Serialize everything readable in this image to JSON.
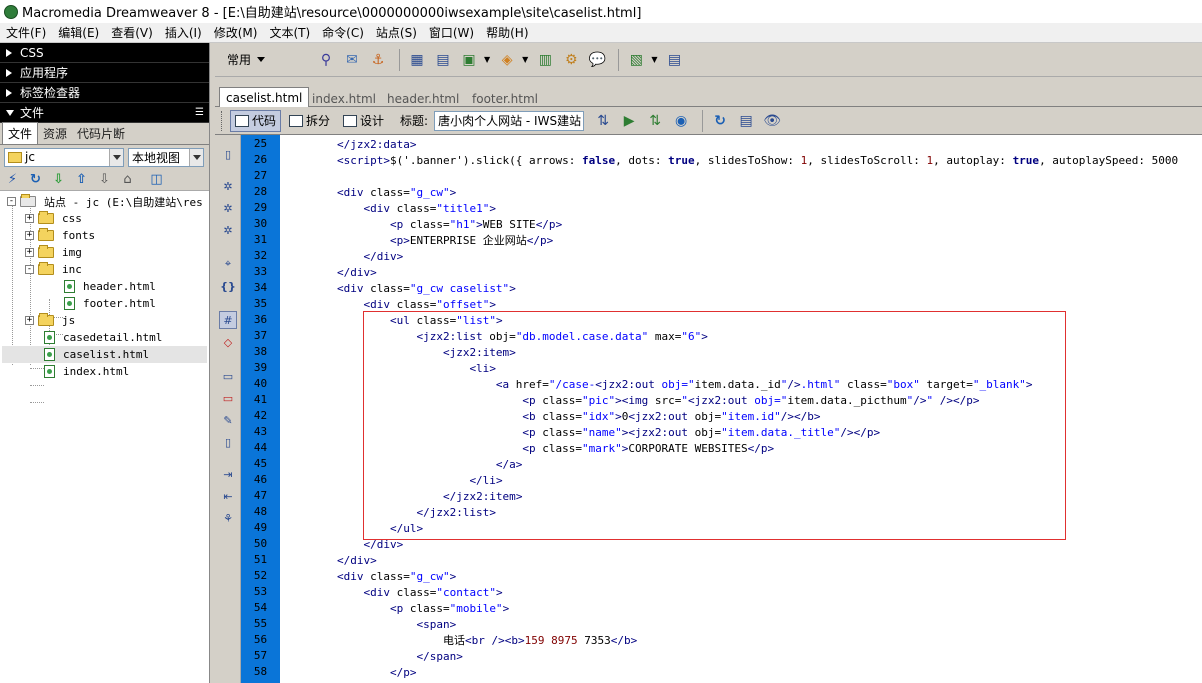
{
  "window": {
    "title": "Macromedia Dreamweaver 8 - [E:\\自助建站\\resource\\0000000000iwsexample\\site\\caselist.html]"
  },
  "menu": [
    "文件(F)",
    "编辑(E)",
    "查看(V)",
    "插入(I)",
    "修改(M)",
    "文本(T)",
    "命令(C)",
    "站点(S)",
    "窗口(W)",
    "帮助(H)"
  ],
  "panels": {
    "css": "CSS",
    "app": "应用程序",
    "tag_inspector": "标签检查器",
    "files": "文件"
  },
  "files_panel": {
    "tabs": [
      "文件",
      "资源",
      "代码片断"
    ],
    "site_select": "jc",
    "view_select": "本地视图",
    "tree": [
      {
        "label": "站点 - jc (E:\\自助建站\\res",
        "type": "site",
        "expander": "-"
      },
      {
        "label": "css",
        "type": "folder",
        "expander": "+"
      },
      {
        "label": "fonts",
        "type": "folder",
        "expander": "+"
      },
      {
        "label": "img",
        "type": "folder",
        "expander": "+"
      },
      {
        "label": "inc",
        "type": "folder",
        "expander": "-"
      },
      {
        "label": "header.html",
        "type": "file"
      },
      {
        "label": "footer.html",
        "type": "file"
      },
      {
        "label": "js",
        "type": "folder",
        "expander": "+"
      },
      {
        "label": "casedetail.html",
        "type": "file"
      },
      {
        "label": "caselist.html",
        "type": "file",
        "selected": true
      },
      {
        "label": "index.html",
        "type": "file"
      }
    ]
  },
  "insert_bar": {
    "category": "常用"
  },
  "doc_tabs": [
    "caselist.html",
    "index.html",
    "header.html",
    "footer.html"
  ],
  "doc_toolbar": {
    "code": "代码",
    "split": "拆分",
    "design": "设计",
    "title_label": "标题:",
    "title_value": "唐小肉个人网站 - IWS建站"
  },
  "editor": {
    "line_numbers": [
      "25",
      "26",
      "27",
      "28",
      "29",
      "30",
      "31",
      "32",
      "33",
      "34",
      "35",
      "36",
      "37",
      "38",
      "39",
      "40",
      "41",
      "42",
      "43",
      "44",
      "45",
      "46",
      "47",
      "48",
      "49",
      "50",
      "51",
      "52",
      "53",
      "54",
      "55",
      "56",
      "57",
      "58"
    ],
    "lines": [
      "        </jzx2:data>",
      "        <script>$('.banner').slick({ arrows: false, dots: true, slidesToShow: 1, slidesToScroll: 1, autoplay: true, autoplaySpeed: 5000",
      "",
      "        <div class=\"g_cw\">",
      "            <div class=\"title1\">",
      "                <p class=\"h1\">WEB SITE</p>",
      "                <p>ENTERPRISE 企业网站</p>",
      "            </div>",
      "        </div>",
      "        <div class=\"g_cw caselist\">",
      "            <div class=\"offset\">",
      "                <ul class=\"list\">",
      "                    <jzx2:list obj=\"db.model.case.data\" max=\"6\">",
      "                        <jzx2:item>",
      "                            <li>",
      "                                <a href=\"/case-<jzx2:out obj=\"item.data._id\"/>.html\" class=\"box\" target=\"_blank\">",
      "                                    <p class=\"pic\"><img src=\"<jzx2:out obj=\"item.data._picthum\"/>\" /></p>",
      "                                    <b class=\"idx\">0<jzx2:out obj=\"item.id\"/></b>",
      "                                    <p class=\"name\"><jzx2:out obj=\"item.data._title\"/></p>",
      "                                    <p class=\"mark\">CORPORATE WEBSITES</p>",
      "                                </a>",
      "                            </li>",
      "                        </jzx2:item>",
      "                    </jzx2:list>",
      "                </ul>",
      "            </div>",
      "        </div>",
      "        <div class=\"g_cw\">",
      "            <div class=\"contact\">",
      "                <p class=\"mobile\">",
      "                    <span>",
      "                        电话<br /><b>159 8975 7353</b>",
      "                    </span>",
      "                </p>"
    ]
  },
  "colors": {
    "gutter": "#0a75d8",
    "highlight_box": "#e03030",
    "tag": "#000080",
    "string": "#0000ff"
  }
}
